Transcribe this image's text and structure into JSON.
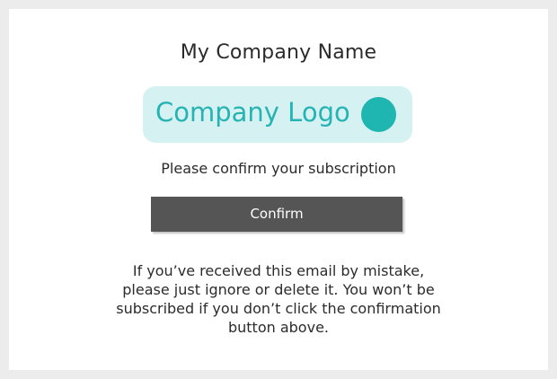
{
  "header": {
    "company_name": "My Company Name"
  },
  "logo": {
    "text": "Company Logo",
    "icon": "circle-icon",
    "colors": {
      "background": "#d6f1f2",
      "text": "#26b3b3",
      "dot": "#1fb5b0"
    }
  },
  "message": {
    "subtitle": "Please confirm your subscription"
  },
  "actions": {
    "confirm_label": "Confirm",
    "button_color": "#555555"
  },
  "disclaimer": {
    "lines": [
      "If you’ve received this email by mistake,",
      "please just ignore or delete it. You won’t be",
      "subscribed if you don’t click the confirmation",
      "button above."
    ]
  }
}
